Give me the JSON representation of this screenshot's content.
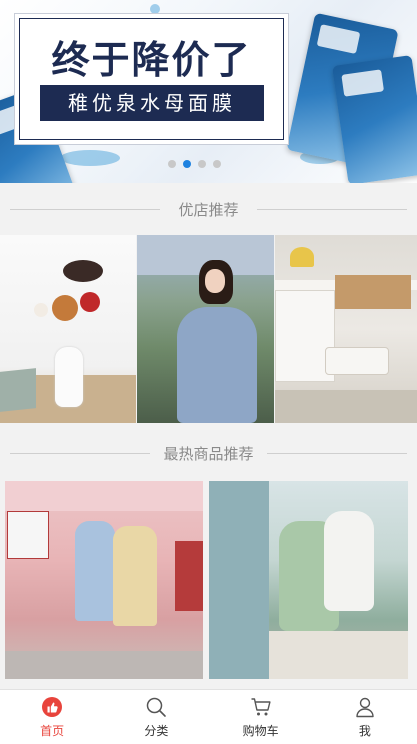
{
  "banner": {
    "headline": "终于降价了",
    "subtitle": "稚优泉水母面膜",
    "dots": 4,
    "active_dot": 2
  },
  "sections": {
    "shops_title": "优店推荐",
    "products_title": "最热商品推荐"
  },
  "tabbar": {
    "items": [
      {
        "label": "首页",
        "icon": "home-thumb-icon",
        "active": true
      },
      {
        "label": "分类",
        "icon": "search-icon",
        "active": false
      },
      {
        "label": "购物车",
        "icon": "cart-icon",
        "active": false
      },
      {
        "label": "我",
        "icon": "user-icon",
        "active": false
      }
    ]
  },
  "colors": {
    "accent": "#e8443c",
    "dot_active": "#1e82e0",
    "banner_navy": "#1d2b52"
  }
}
